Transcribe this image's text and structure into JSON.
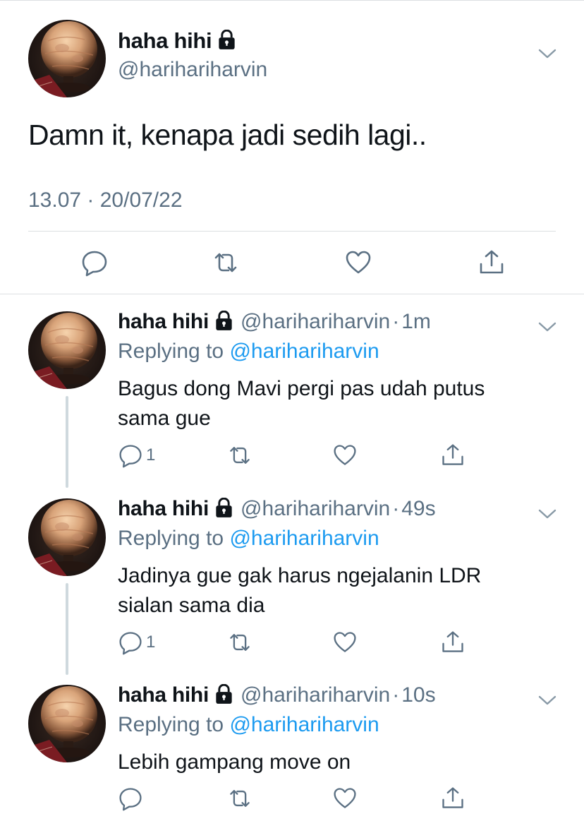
{
  "main_tweet": {
    "display_name": "haha hihi",
    "handle": "@harihariharvin",
    "text": "Damn it, kenapa jadi sedih lagi..",
    "timestamp": "13.07 · 20/07/22",
    "actions": [
      "reply-icon",
      "retweet-icon",
      "like-icon",
      "share-icon"
    ]
  },
  "replies": [
    {
      "display_name": "haha hihi",
      "handle": "@harihariharvin",
      "separator": "·",
      "time_ago": "1m",
      "replying_prefix": "Replying to",
      "replying_to": "@harihariharvin",
      "text": "Bagus dong Mavi pergi pas udah putus sama gue",
      "reply_count": "1"
    },
    {
      "display_name": "haha hihi",
      "handle": "@harihariharvin",
      "separator": "·",
      "time_ago": "49s",
      "replying_prefix": "Replying to",
      "replying_to": "@harihariharvin",
      "text": "Jadinya gue gak harus ngejalanin LDR sialan sama dia",
      "reply_count": "1"
    },
    {
      "display_name": "haha hihi",
      "handle": "@harihariharvin",
      "separator": "·",
      "time_ago": "10s",
      "replying_prefix": "Replying to",
      "replying_to": "@harihariharvin",
      "text": "Lebih gampang move on",
      "reply_count": ""
    }
  ],
  "colors": {
    "text": "#0f1419",
    "secondary": "#5b7083",
    "link": "#1d9bf0",
    "divider": "#dcdfe2"
  }
}
